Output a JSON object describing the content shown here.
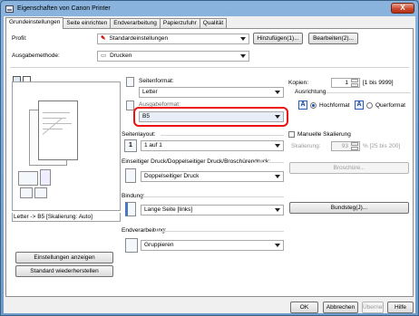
{
  "window": {
    "title": "Eigenschaften von Canon Printer",
    "close_glyph": "X"
  },
  "tabs": [
    {
      "label": "Grundeinstellungen"
    },
    {
      "label": "Seite einrichten"
    },
    {
      "label": "Endverarbeitung"
    },
    {
      "label": "Papierzufuhr"
    },
    {
      "label": "Qualität"
    }
  ],
  "profile": {
    "label": "Profil:",
    "value": "Standardeinstellungen",
    "add_button": "Hinzufügen(1)...",
    "edit_button": "Bearbeiten(2)..."
  },
  "output_method": {
    "label": "Ausgabemethode:",
    "value": "Drucken"
  },
  "page_size": {
    "label": "Seitenformat:",
    "value": "Letter"
  },
  "output_size": {
    "label": "Ausgabeformat:",
    "value": "B5"
  },
  "preview": {
    "caption": "Letter -> B5 [Skalierung: Auto]"
  },
  "copies": {
    "label": "Kopien:",
    "value": "1",
    "range": "[1 bis 9999]"
  },
  "orientation": {
    "label": "Ausrichtung",
    "portrait": "Hochformat",
    "landscape": "Querformat",
    "selected": "portrait"
  },
  "manual_scaling": {
    "label": "Manuelle Skalierung",
    "checked": false
  },
  "scaling": {
    "label": "Skalierung:",
    "value": "93",
    "range": "% [25 bis 200]"
  },
  "page_layout": {
    "label": "Seitenlayout:",
    "value": "1 auf 1"
  },
  "print_style": {
    "label": "Einseitiger Druck/Doppelseitiger Druck/Broschürendruck:",
    "value": "Doppelseitiger Druck"
  },
  "booklet_button": "Broschüre...",
  "binding": {
    "label": "Bindung:",
    "value": "Lange Seite [links]",
    "button": "Bundsteg(J)..."
  },
  "finishing": {
    "label": "Endverarbeitung:",
    "value": "Gruppieren"
  },
  "left_buttons": {
    "show_settings": "Einstellungen anzeigen",
    "restore_defaults": "Standard wiederherstellen"
  },
  "bottom_buttons": {
    "ok": "OK",
    "cancel": "Abbrechen",
    "apply": "Übernehmen",
    "help": "Hilfe"
  }
}
